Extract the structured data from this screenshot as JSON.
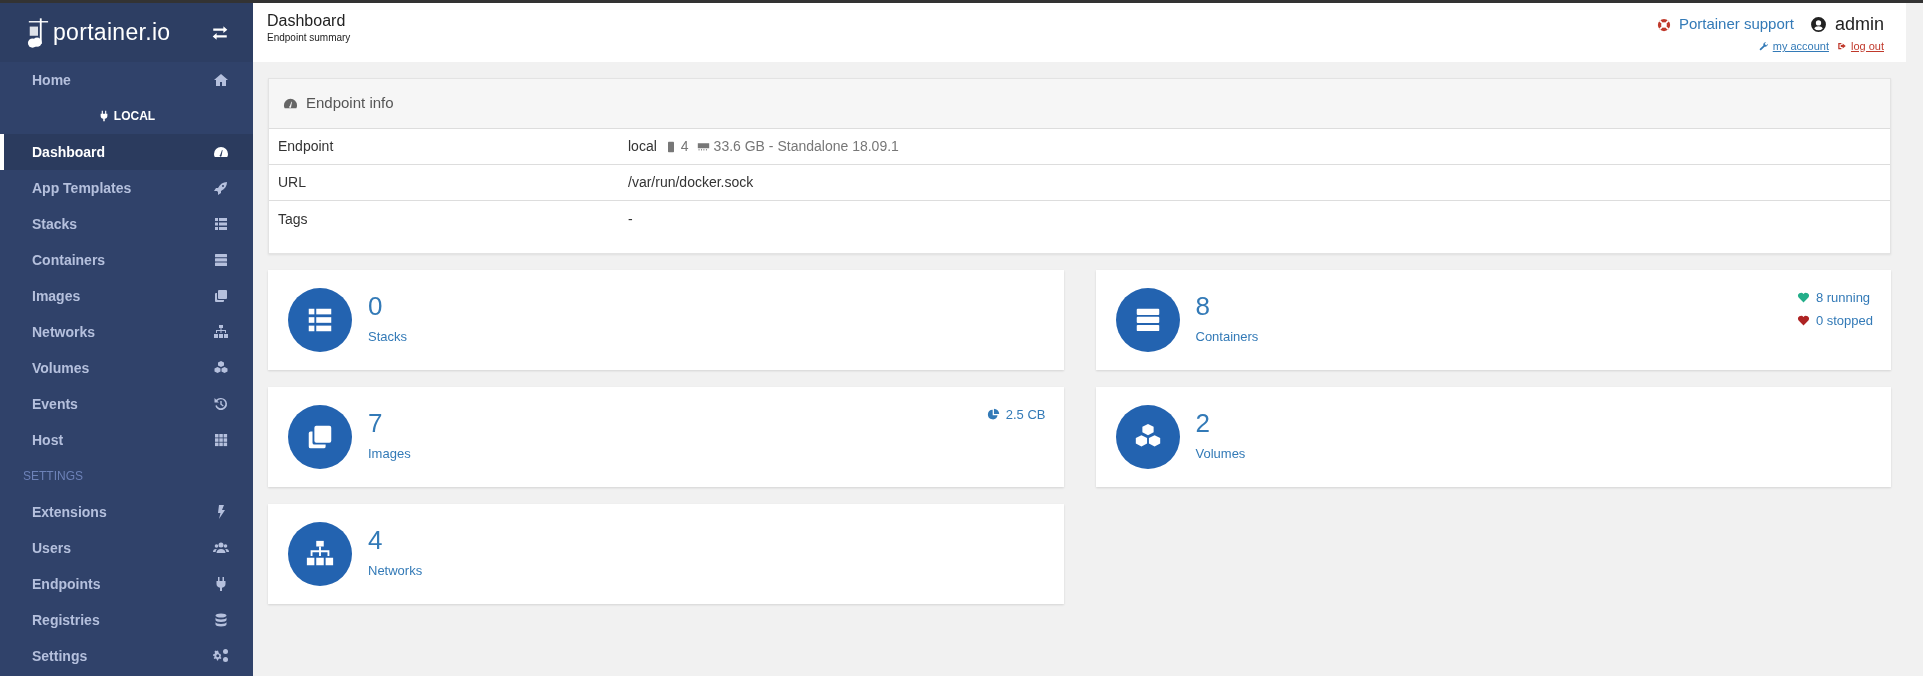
{
  "sidebar": {
    "brand": "portainer.io",
    "items": [
      {
        "kind": "link",
        "label": "Home",
        "selected": false
      },
      {
        "kind": "endpoint",
        "label": "LOCAL"
      },
      {
        "kind": "link",
        "label": "Dashboard",
        "selected": true
      },
      {
        "kind": "link",
        "label": "App Templates",
        "selected": false
      },
      {
        "kind": "link",
        "label": "Stacks",
        "selected": false
      },
      {
        "kind": "link",
        "label": "Containers",
        "selected": false
      },
      {
        "kind": "link",
        "label": "Images",
        "selected": false
      },
      {
        "kind": "link",
        "label": "Networks",
        "selected": false
      },
      {
        "kind": "link",
        "label": "Volumes",
        "selected": false
      },
      {
        "kind": "link",
        "label": "Events",
        "selected": false
      },
      {
        "kind": "link",
        "label": "Host",
        "selected": false
      },
      {
        "kind": "section",
        "label": "SETTINGS"
      },
      {
        "kind": "link",
        "label": "Extensions",
        "selected": false
      },
      {
        "kind": "link",
        "label": "Users",
        "selected": false
      },
      {
        "kind": "link",
        "label": "Endpoints",
        "selected": false
      },
      {
        "kind": "link",
        "label": "Registries",
        "selected": false
      },
      {
        "kind": "link",
        "label": "Settings",
        "selected": false
      }
    ]
  },
  "header": {
    "title": "Dashboard",
    "subtitle": "Endpoint summary",
    "support": "Portainer support",
    "user": "admin",
    "my_account": "my account",
    "log_out": "log out"
  },
  "endpoint_info": {
    "title": "Endpoint info",
    "rows": [
      {
        "label": "Endpoint",
        "value": "local",
        "cpu": "4",
        "memory": "33.6 GB - Standalone 18.09.1"
      },
      {
        "label": "URL",
        "value": "/var/run/docker.sock"
      },
      {
        "label": "Tags",
        "value": "-"
      }
    ]
  },
  "stats": [
    {
      "count": "0",
      "label": "Stacks"
    },
    {
      "count": "8",
      "label": "Containers",
      "extras": [
        {
          "kind": "running",
          "text": "8 running"
        },
        {
          "kind": "stopped",
          "text": "0 stopped"
        }
      ]
    },
    {
      "count": "7",
      "label": "Images",
      "extras": [
        {
          "kind": "size",
          "text": "2.5 CB"
        }
      ]
    },
    {
      "count": "2",
      "label": "Volumes"
    },
    {
      "count": "4",
      "label": "Networks"
    }
  ]
}
